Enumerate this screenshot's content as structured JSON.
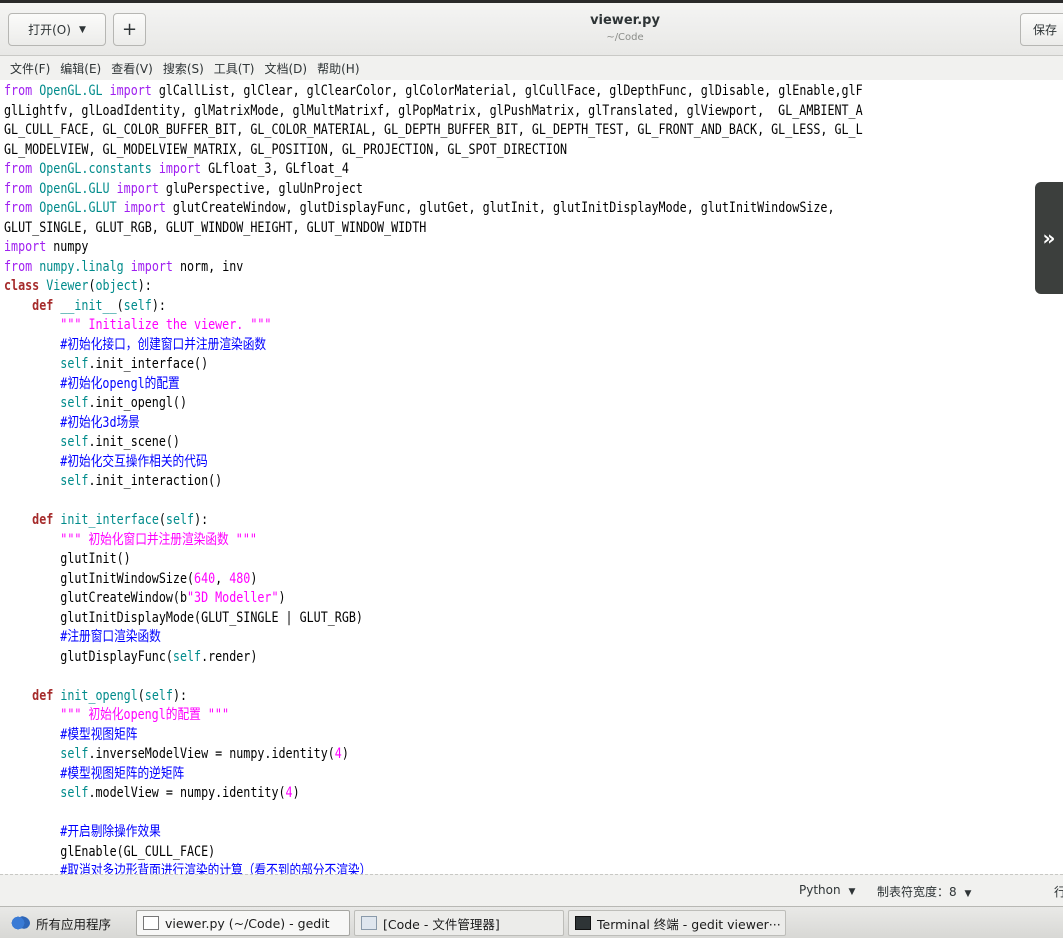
{
  "headerbar": {
    "open_label": "打开(O)",
    "open_icon": "chevron-down-icon",
    "new_label": "+",
    "title": "viewer.py",
    "subtitle": "~/Code",
    "save_label": "保存"
  },
  "menubar": {
    "items": [
      "文件(F)",
      "编辑(E)",
      "查看(V)",
      "搜索(S)",
      "工具(T)",
      "文档(D)",
      "帮助(H)"
    ]
  },
  "editor": {
    "language": "Python",
    "code_lines": [
      "from OpenGL.GL import glCallList, glClear, glClearColor, glColorMaterial, glCullFace, glDepthFunc, glDisable, glEnable,glF",
      "glLightfv, glLoadIdentity, glMatrixMode, glMultMatrixf, glPopMatrix, glPushMatrix, glTranslated, glViewport,  GL_AMBIENT_A",
      "GL_CULL_FACE, GL_COLOR_BUFFER_BIT, GL_COLOR_MATERIAL, GL_DEPTH_BUFFER_BIT, GL_DEPTH_TEST, GL_FRONT_AND_BACK, GL_LESS, GL_L",
      "GL_MODELVIEW, GL_MODELVIEW_MATRIX, GL_POSITION, GL_PROJECTION, GL_SPOT_DIRECTION",
      "from OpenGL.constants import GLfloat_3, GLfloat_4",
      "from OpenGL.GLU import gluPerspective, gluUnProject",
      "from OpenGL.GLUT import glutCreateWindow, glutDisplayFunc, glutGet, glutInit, glutInitDisplayMode, glutInitWindowSize,",
      "GLUT_SINGLE, GLUT_RGB, GLUT_WINDOW_HEIGHT, GLUT_WINDOW_WIDTH",
      "import numpy",
      "from numpy.linalg import norm, inv",
      "class Viewer(object):",
      "    def __init__(self):",
      "        \"\"\" Initialize the viewer. \"\"\"",
      "        #初始化接口，创建窗口并注册渲染函数",
      "        self.init_interface()",
      "        #初始化opengl的配置",
      "        self.init_opengl()",
      "        #初始化3d场景",
      "        self.init_scene()",
      "        #初始化交互操作相关的代码",
      "        self.init_interaction()",
      "",
      "    def init_interface(self):",
      "        \"\"\" 初始化窗口并注册渲染函数 \"\"\"",
      "        glutInit()",
      "        glutInitWindowSize(640, 480)",
      "        glutCreateWindow(b\"3D Modeller\")",
      "        glutInitDisplayMode(GLUT_SINGLE | GLUT_RGB)",
      "        #注册窗口渲染函数",
      "        glutDisplayFunc(self.render)",
      "",
      "    def init_opengl(self):",
      "        \"\"\" 初始化opengl的配置 \"\"\"",
      "        #模型视图矩阵",
      "        self.inverseModelView = numpy.identity(4)",
      "        #模型视图矩阵的逆矩阵",
      "        self.modelView = numpy.identity(4)",
      "",
      "        #开启剔除操作效果",
      "        glEnable(GL_CULL_FACE)",
      "        #取消对多边形背面进行渲染的计算（看不到的部分不渲染）"
    ]
  },
  "side_tab": {
    "icon": "double-chevron-right-icon",
    "glyph": "»"
  },
  "statusbar": {
    "language": "Python",
    "tab_width": "制表符宽度：8",
    "position_stub": "行"
  },
  "taskbar": {
    "apps": "所有应用程序",
    "tasks": [
      "viewer.py (~/Code) - gedit",
      "[Code - 文件管理器]",
      "Terminal 终端 - gedit viewer···"
    ]
  }
}
